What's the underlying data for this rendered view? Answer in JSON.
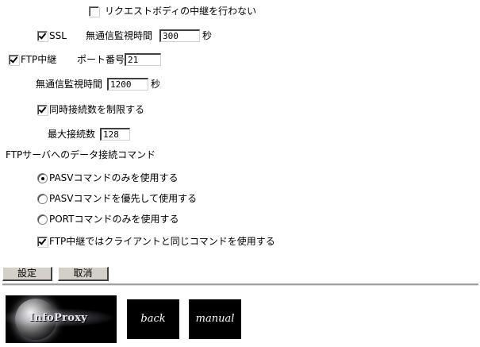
{
  "options": {
    "no_relay_request_body": {
      "label": "リクエストボディの中継を行わない",
      "checked": false
    },
    "ssl": {
      "label": "SSL",
      "checked": true,
      "idle_timeout_label": "無通信監視時間",
      "idle_timeout_value": "300",
      "unit": "秒"
    },
    "ftp_relay": {
      "label": "FTP中継",
      "checked": true,
      "port_label": "ポート番号",
      "port_value": "21",
      "idle_timeout_label": "無通信監視時間",
      "idle_timeout_value": "1200",
      "unit": "秒",
      "limit_connections": {
        "label": "同時接続数を制限する",
        "checked": true
      },
      "max_connections_label": "最大接続数",
      "max_connections_value": "128"
    }
  },
  "ftp_command": {
    "heading": "FTPサーバへのデータ接続コマンド",
    "choices": [
      {
        "label": "PASVコマンドのみを使用する",
        "selected": true
      },
      {
        "label": "PASVコマンドを優先して使用する",
        "selected": false
      },
      {
        "label": "PORTコマンドのみを使用する",
        "selected": false
      }
    ],
    "same_as_client": {
      "label": "FTP中継ではクライアントと同じコマンドを使用する",
      "checked": true
    }
  },
  "buttons": {
    "submit": "設定",
    "cancel": "取消"
  },
  "footer": {
    "logo_text": "InfoProxy",
    "back": "back",
    "manual": "manual"
  }
}
